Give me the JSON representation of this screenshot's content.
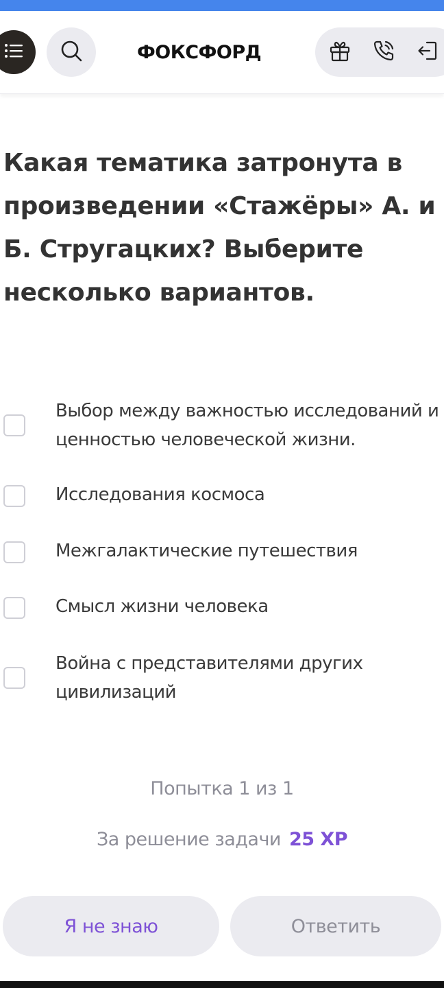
{
  "header": {
    "logo": "ФОКСФОРД",
    "icons": {
      "menu": "list-icon",
      "search": "search-icon",
      "gift": "gift-icon",
      "phone": "phone-icon",
      "login": "login-icon"
    }
  },
  "question": {
    "text": "Какая тематика затронута в произведении «Стажёры» А. и Б. Стругацких? Выберите несколько вариантов."
  },
  "options": [
    {
      "label": "Выбор между важностью исследований и ценностью человеческой жизни.",
      "checked": false
    },
    {
      "label": "Исследования космоса",
      "checked": false
    },
    {
      "label": "Межгалактические путешествия",
      "checked": false
    },
    {
      "label": "Смысл жизни человека",
      "checked": false
    },
    {
      "label": "Война с представителями других цивилизаций",
      "checked": false
    }
  ],
  "attempt": {
    "text": "Попытка 1 из 1"
  },
  "reward": {
    "label": "За решение задачи",
    "value": "25 XP"
  },
  "buttons": {
    "dont_know": "Я не знаю",
    "answer": "Ответить"
  },
  "colors": {
    "accent": "#7e52d6",
    "top_strip": "#4585ec",
    "button_bg": "#ebebf0",
    "muted_text": "#8e8e98"
  }
}
